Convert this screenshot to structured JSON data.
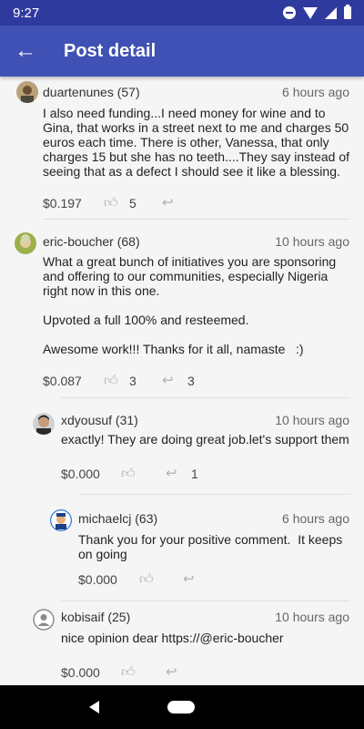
{
  "status_bar": {
    "time": "9:27"
  },
  "app_bar": {
    "title": "Post detail",
    "back_icon": "arrow-back-icon"
  },
  "comments": [
    {
      "author": "duartenunes (57)",
      "time": "6 hours ago",
      "body": "I also need funding...I need money for wine and to Gina, that works in a street next to me and charges 50 euros each time. There is other, Vanessa, that only charges 15 but she has no teeth....They say instead of seeing that as a defect I should see it like a blessing.",
      "payout": "$0.197",
      "votes": "5",
      "replies": ""
    },
    {
      "author": "eric-boucher (68)",
      "time": "10 hours ago",
      "body": "What a great bunch of initiatives you are sponsoring and offering to our communities, especially Nigeria right now in this one.\n\nUpvoted a full 100% and resteemed.\n\nAwesome work!!! Thanks for it all, namaste   :)",
      "payout": "$0.087",
      "votes": "3",
      "replies": "3"
    },
    {
      "author": "xdyousuf (31)",
      "time": "10 hours ago",
      "body": "exactly! They are doing great job.let's support them",
      "payout": "$0.000",
      "votes": "",
      "replies": "1"
    },
    {
      "author": "michaelcj (63)",
      "time": "6 hours ago",
      "body": "Thank you for your positive comment.  It keeps on going",
      "payout": "$0.000",
      "votes": "",
      "replies": ""
    },
    {
      "author": "kobisaif (25)",
      "time": "10 hours ago",
      "body": "nice opinion dear https://@eric-boucher",
      "payout": "$0.000",
      "votes": "",
      "replies": ""
    }
  ],
  "colors": {
    "app_bar": "#3f51b5",
    "status_bar": "#2f3a9e"
  }
}
